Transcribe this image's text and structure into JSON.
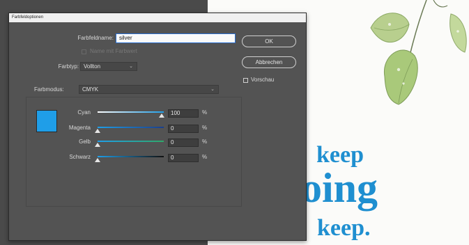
{
  "dialog": {
    "title": "Farbfeldoptionen",
    "name_label": "Farbfeldname:",
    "name_value": "silver",
    "name_with_value_label": "Name mit Farbwert",
    "type_label": "Farbtyp:",
    "type_value": "Vollton",
    "mode_label": "Farbmodus:",
    "mode_value": "CMYK",
    "ok_label": "OK",
    "cancel_label": "Abbrechen",
    "preview_label": "Vorschau",
    "swatch_color": "#1f9ee8",
    "channels": [
      {
        "label": "Cyan",
        "value": "100",
        "unit": "%",
        "level": 1.0
      },
      {
        "label": "Magenta",
        "value": "0",
        "unit": "%",
        "level": 0.0
      },
      {
        "label": "Gelb",
        "value": "0",
        "unit": "%",
        "level": 0.0
      },
      {
        "label": "Schwarz",
        "value": "0",
        "unit": "%",
        "level": 0.0
      }
    ]
  },
  "poster": {
    "line1": "keep",
    "line2": "oing",
    "line3": "keep."
  },
  "colors": {
    "accent": "#1f8fd0"
  }
}
